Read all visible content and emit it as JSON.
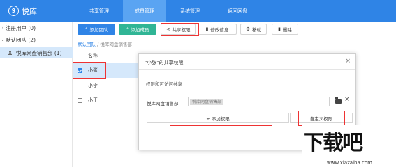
{
  "header": {
    "logo_glyph": "9",
    "logo_text": "悦库",
    "tabs": [
      "共享管理",
      "成员管理",
      "系统管理",
      "返回网盘"
    ],
    "active_tab": 1
  },
  "sidebar": {
    "items": [
      {
        "label": "注册用户 (0)",
        "expandable": true,
        "expanded": false
      },
      {
        "label": "默认团队 (2)",
        "expandable": true,
        "expanded": true
      },
      {
        "label": "悦库网盘销售部 (1)",
        "selected": true
      }
    ]
  },
  "toolbar": {
    "add_team": "添加团队",
    "add_member": "添加成员",
    "share_perm": "共享权限",
    "edit_info": "修改信息",
    "move": "移动",
    "delete": "删除"
  },
  "breadcrumb": {
    "root": "默认团队",
    "separator": "/",
    "current": "悦库网盘销售部"
  },
  "list": {
    "header": "名称",
    "rows": [
      {
        "name": "小张",
        "checked": true,
        "selected": true
      },
      {
        "name": "小李",
        "checked": false
      },
      {
        "name": "小王",
        "checked": false
      }
    ]
  },
  "dialog": {
    "title": "\"小张\"的共享权限",
    "close": "×",
    "subtitle": "权限和可访问共享",
    "perm_label": "悦库网盘销售部",
    "perm_tag": "悦库网盘销售部",
    "remove": "×",
    "add_perm": "+ 添加权限",
    "custom_perm": "自定义权限"
  },
  "watermark": {
    "text": "下载吧",
    "url": "www.xiazaiba.com"
  },
  "colors": {
    "primary": "#2f84e6",
    "green": "#30b595",
    "highlight": "#e33333",
    "selected_bg": "#d5e8fb"
  }
}
